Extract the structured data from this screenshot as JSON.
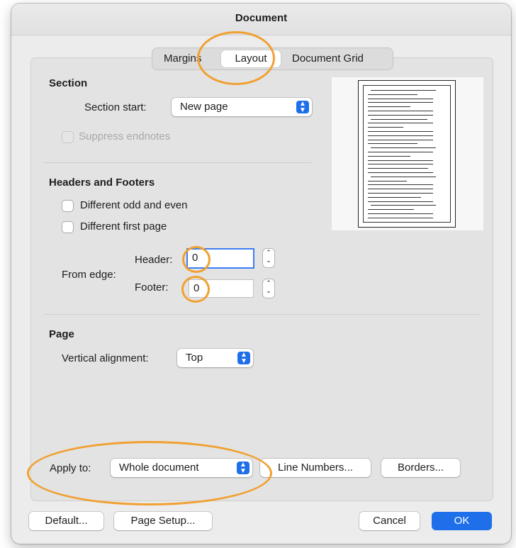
{
  "window": {
    "title": "Document"
  },
  "tabs": [
    "Margins",
    "Layout",
    "Document Grid"
  ],
  "section": {
    "title": "Section",
    "start_label": "Section start:",
    "start_value": "New page",
    "suppress_endnotes": "Suppress endnotes"
  },
  "headers_footers": {
    "title": "Headers and Footers",
    "odd_even": "Different odd and even",
    "first_page": "Different first page",
    "from_edge": "From edge:",
    "header_label": "Header:",
    "header_value": "0",
    "footer_label": "Footer:",
    "footer_value": "0"
  },
  "page": {
    "title": "Page",
    "valign_label": "Vertical alignment:",
    "valign_value": "Top"
  },
  "apply": {
    "label": "Apply to:",
    "value": "Whole document",
    "line_numbers": "Line Numbers...",
    "borders": "Borders..."
  },
  "footer_buttons": {
    "default": "Default...",
    "page_setup": "Page Setup...",
    "cancel": "Cancel",
    "ok": "OK"
  },
  "colors": {
    "accent": "#1f6feb",
    "annotation": "#f0a030"
  }
}
